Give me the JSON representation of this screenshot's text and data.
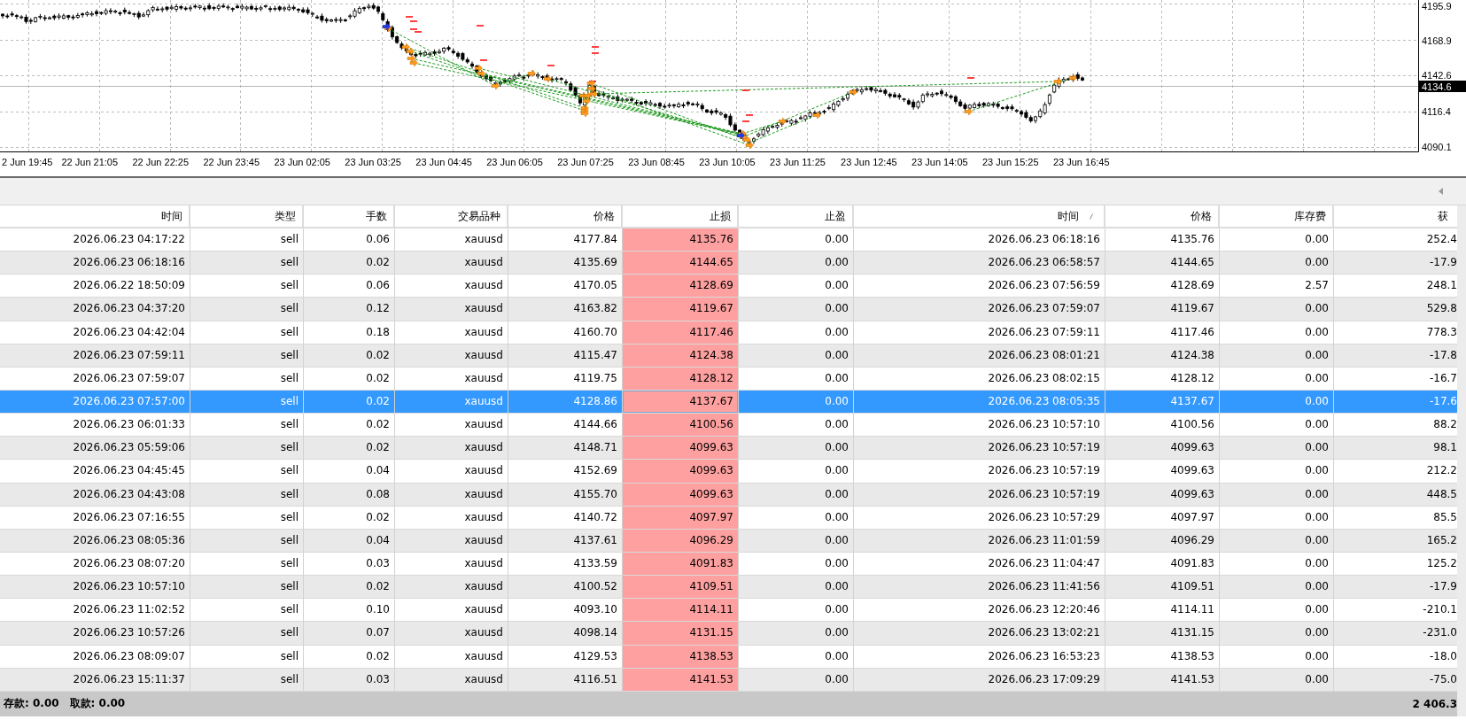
{
  "chart": {
    "price_labels": [
      "4195.9",
      "4168.9",
      "4142.6",
      "4116.4",
      "4090.1"
    ],
    "current_price": "4134.6",
    "time_labels": [
      "2 Jun 19:45",
      "22 Jun 21:05",
      "22 Jun 22:25",
      "22 Jun 23:45",
      "23 Jun 02:05",
      "23 Jun 03:25",
      "23 Jun 04:45",
      "23 Jun 06:05",
      "23 Jun 07:25",
      "23 Jun 08:45",
      "23 Jun 10:05",
      "23 Jun 11:25",
      "23 Jun 12:45",
      "23 Jun 14:05",
      "23 Jun 15:25",
      "23 Jun 16:45"
    ]
  },
  "table": {
    "columns": [
      {
        "label": "时间",
        "kind": "value",
        "sorted": false
      },
      {
        "label": "类型",
        "kind": "value",
        "sorted": false
      },
      {
        "label": "手数",
        "kind": "value",
        "sorted": false
      },
      {
        "label": "交易品种",
        "kind": "value",
        "sorted": false
      },
      {
        "label": "价格",
        "kind": "value",
        "sorted": false
      },
      {
        "label": "止损",
        "kind": "stop_loss",
        "sorted": false
      },
      {
        "label": "止盈",
        "kind": "value",
        "sorted": false
      },
      {
        "label": "时间",
        "kind": "value",
        "sorted": true
      },
      {
        "label": "价格",
        "kind": "value",
        "sorted": false
      },
      {
        "label": "库存费",
        "kind": "value",
        "sorted": false
      },
      {
        "label": "获",
        "kind": "value",
        "sorted": false
      }
    ],
    "rows": [
      {
        "selected": false,
        "stop_loss_hit": true,
        "cells": [
          "2026.06.23 04:17:22",
          "sell",
          "0.06",
          "xauusd",
          "4177.84",
          "4135.76",
          "0.00",
          "2026.06.23 06:18:16",
          "4135.76",
          "0.00",
          "252.4"
        ]
      },
      {
        "selected": false,
        "stop_loss_hit": true,
        "cells": [
          "2026.06.23 06:18:16",
          "sell",
          "0.02",
          "xauusd",
          "4135.69",
          "4144.65",
          "0.00",
          "2026.06.23 06:58:57",
          "4144.65",
          "0.00",
          "-17.9"
        ]
      },
      {
        "selected": false,
        "stop_loss_hit": true,
        "cells": [
          "2026.06.22 18:50:09",
          "sell",
          "0.06",
          "xauusd",
          "4170.05",
          "4128.69",
          "0.00",
          "2026.06.23 07:56:59",
          "4128.69",
          "2.57",
          "248.1"
        ]
      },
      {
        "selected": false,
        "stop_loss_hit": true,
        "cells": [
          "2026.06.23 04:37:20",
          "sell",
          "0.12",
          "xauusd",
          "4163.82",
          "4119.67",
          "0.00",
          "2026.06.23 07:59:07",
          "4119.67",
          "0.00",
          "529.8"
        ]
      },
      {
        "selected": false,
        "stop_loss_hit": true,
        "cells": [
          "2026.06.23 04:42:04",
          "sell",
          "0.18",
          "xauusd",
          "4160.70",
          "4117.46",
          "0.00",
          "2026.06.23 07:59:11",
          "4117.46",
          "0.00",
          "778.3"
        ]
      },
      {
        "selected": false,
        "stop_loss_hit": true,
        "cells": [
          "2026.06.23 07:59:11",
          "sell",
          "0.02",
          "xauusd",
          "4115.47",
          "4124.38",
          "0.00",
          "2026.06.23 08:01:21",
          "4124.38",
          "0.00",
          "-17.8"
        ]
      },
      {
        "selected": false,
        "stop_loss_hit": true,
        "cells": [
          "2026.06.23 07:59:07",
          "sell",
          "0.02",
          "xauusd",
          "4119.75",
          "4128.12",
          "0.00",
          "2026.06.23 08:02:15",
          "4128.12",
          "0.00",
          "-16.7"
        ]
      },
      {
        "selected": true,
        "stop_loss_hit": true,
        "cells": [
          "2026.06.23 07:57:00",
          "sell",
          "0.02",
          "xauusd",
          "4128.86",
          "4137.67",
          "0.00",
          "2026.06.23 08:05:35",
          "4137.67",
          "0.00",
          "-17.6"
        ]
      },
      {
        "selected": false,
        "stop_loss_hit": true,
        "cells": [
          "2026.06.23 06:01:33",
          "sell",
          "0.02",
          "xauusd",
          "4144.66",
          "4100.56",
          "0.00",
          "2026.06.23 10:57:10",
          "4100.56",
          "0.00",
          "88.2"
        ]
      },
      {
        "selected": false,
        "stop_loss_hit": true,
        "cells": [
          "2026.06.23 05:59:06",
          "sell",
          "0.02",
          "xauusd",
          "4148.71",
          "4099.63",
          "0.00",
          "2026.06.23 10:57:19",
          "4099.63",
          "0.00",
          "98.1"
        ]
      },
      {
        "selected": false,
        "stop_loss_hit": true,
        "cells": [
          "2026.06.23 04:45:45",
          "sell",
          "0.04",
          "xauusd",
          "4152.69",
          "4099.63",
          "0.00",
          "2026.06.23 10:57:19",
          "4099.63",
          "0.00",
          "212.2"
        ]
      },
      {
        "selected": false,
        "stop_loss_hit": true,
        "cells": [
          "2026.06.23 04:43:08",
          "sell",
          "0.08",
          "xauusd",
          "4155.70",
          "4099.63",
          "0.00",
          "2026.06.23 10:57:19",
          "4099.63",
          "0.00",
          "448.5"
        ]
      },
      {
        "selected": false,
        "stop_loss_hit": true,
        "cells": [
          "2026.06.23 07:16:55",
          "sell",
          "0.02",
          "xauusd",
          "4140.72",
          "4097.97",
          "0.00",
          "2026.06.23 10:57:29",
          "4097.97",
          "0.00",
          "85.5"
        ]
      },
      {
        "selected": false,
        "stop_loss_hit": true,
        "cells": [
          "2026.06.23 08:05:36",
          "sell",
          "0.04",
          "xauusd",
          "4137.61",
          "4096.29",
          "0.00",
          "2026.06.23 11:01:59",
          "4096.29",
          "0.00",
          "165.2"
        ]
      },
      {
        "selected": false,
        "stop_loss_hit": true,
        "cells": [
          "2026.06.23 08:07:20",
          "sell",
          "0.03",
          "xauusd",
          "4133.59",
          "4091.83",
          "0.00",
          "2026.06.23 11:04:47",
          "4091.83",
          "0.00",
          "125.2"
        ]
      },
      {
        "selected": false,
        "stop_loss_hit": true,
        "cells": [
          "2026.06.23 10:57:10",
          "sell",
          "0.02",
          "xauusd",
          "4100.52",
          "4109.51",
          "0.00",
          "2026.06.23 11:41:56",
          "4109.51",
          "0.00",
          "-17.9"
        ]
      },
      {
        "selected": false,
        "stop_loss_hit": true,
        "cells": [
          "2026.06.23 11:02:52",
          "sell",
          "0.10",
          "xauusd",
          "4093.10",
          "4114.11",
          "0.00",
          "2026.06.23 12:20:46",
          "4114.11",
          "0.00",
          "-210.1"
        ]
      },
      {
        "selected": false,
        "stop_loss_hit": true,
        "cells": [
          "2026.06.23 10:57:26",
          "sell",
          "0.07",
          "xauusd",
          "4098.14",
          "4131.15",
          "0.00",
          "2026.06.23 13:02:21",
          "4131.15",
          "0.00",
          "-231.0"
        ]
      },
      {
        "selected": false,
        "stop_loss_hit": true,
        "cells": [
          "2026.06.23 08:09:07",
          "sell",
          "0.02",
          "xauusd",
          "4129.53",
          "4138.53",
          "0.00",
          "2026.06.23 16:53:23",
          "4138.53",
          "0.00",
          "-18.0"
        ]
      },
      {
        "selected": false,
        "stop_loss_hit": true,
        "cells": [
          "2026.06.23 15:11:37",
          "sell",
          "0.03",
          "xauusd",
          "4116.51",
          "4141.53",
          "0.00",
          "2026.06.23 17:09:29",
          "4141.53",
          "0.00",
          "-75.0"
        ]
      }
    ]
  },
  "status_bar": {
    "items": [
      "存款: 0.00",
      "取款: 0.00"
    ],
    "total": "2 406.3"
  }
}
